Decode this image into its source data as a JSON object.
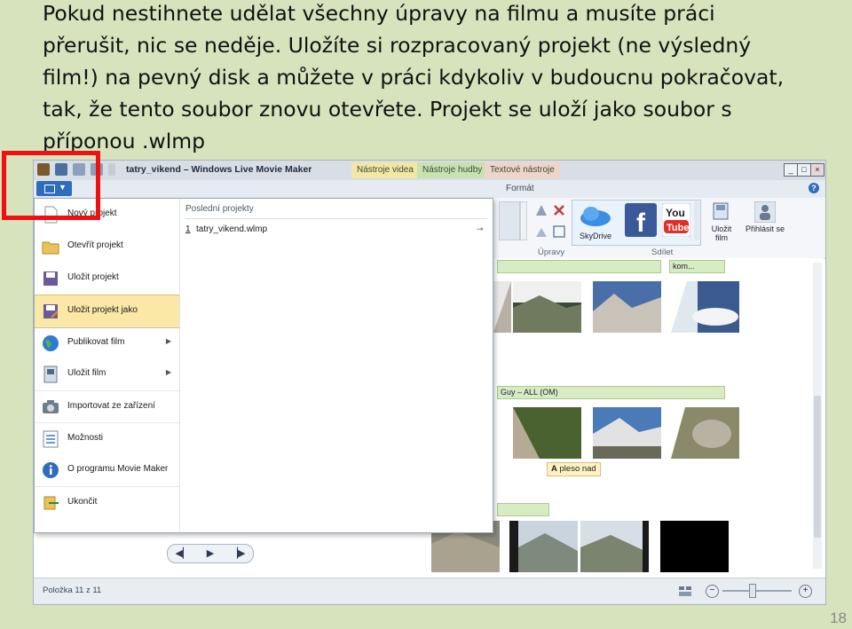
{
  "slide": {
    "lines": [
      "Pokud nestihnete udělat všechny úpravy na filmu a musíte práci",
      "přerušit, nic se neděje. Uložíte si rozpracovaný projekt (ne výsledný",
      "film!) na pevný disk a můžete v práci kdykoliv v budoucnu pokračovat,",
      "tak, že tento soubor znovu otevřete. Projekt se uloží jako soubor s",
      "příponou .wlmp"
    ],
    "page_number": "18"
  },
  "window": {
    "title": "tatry_vikend – Windows Live Movie Maker",
    "context_tabs": [
      "Nástroje videa",
      "Nástroje hudby",
      "Textové nástroje"
    ],
    "ribbon_tab": "Formát",
    "help": "?"
  },
  "ribbon": {
    "groups": [
      "Úpravy",
      "Sdílet"
    ],
    "skydrive": "SkyDrive",
    "save_movie": "Uložit film",
    "sign_in": "Přihlásit se"
  },
  "file_menu": {
    "items": [
      {
        "label": "Nový projekt",
        "icon": "new-document-icon"
      },
      {
        "label": "Otevřít projekt",
        "icon": "open-folder-icon"
      },
      {
        "label": "Uložit projekt",
        "icon": "save-icon"
      },
      {
        "label": "Uložit projekt jako",
        "icon": "save-as-icon",
        "selected": true
      },
      {
        "label": "Publikovat film",
        "icon": "globe-icon",
        "submenu": true
      },
      {
        "label": "Uložit film",
        "icon": "film-save-icon",
        "submenu": true
      },
      {
        "label": "Importovat ze zařízení",
        "icon": "camera-icon"
      },
      {
        "label": "Možnosti",
        "icon": "options-icon"
      },
      {
        "label": "O programu Movie Maker",
        "icon": "info-icon"
      },
      {
        "label": "Ukončit",
        "icon": "exit-icon"
      }
    ],
    "recent_heading": "Poslední projekty",
    "recent": [
      {
        "number": "1",
        "name": "tatry_vikend.wlmp"
      }
    ]
  },
  "timeline": {
    "music_labels": [
      "kom...",
      "Guy – ALL (OM)"
    ],
    "caption": "pleso nad"
  },
  "status": {
    "item_count": "Položka 11 z 11"
  },
  "colors": {
    "slide_bg": "#d6e3bc",
    "highlight_box": "#ee1111",
    "selected_item": "#fbe7a6",
    "file_button": "#2e6dbd"
  }
}
